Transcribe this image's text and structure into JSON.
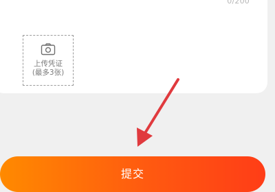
{
  "form": {
    "char_counter": "0/200",
    "upload": {
      "line1": "上传凭证",
      "line2": "(最多3张)",
      "icon": "camera-icon"
    }
  },
  "submit": {
    "label": "提交",
    "gradient_start": "#ff8a00",
    "gradient_end": "#ff3d17"
  },
  "annotation": {
    "icon": "arrow-icon",
    "color": "#e03a3e"
  },
  "colors": {
    "page_background": "#f0f0f0",
    "card_background": "#ffffff"
  }
}
